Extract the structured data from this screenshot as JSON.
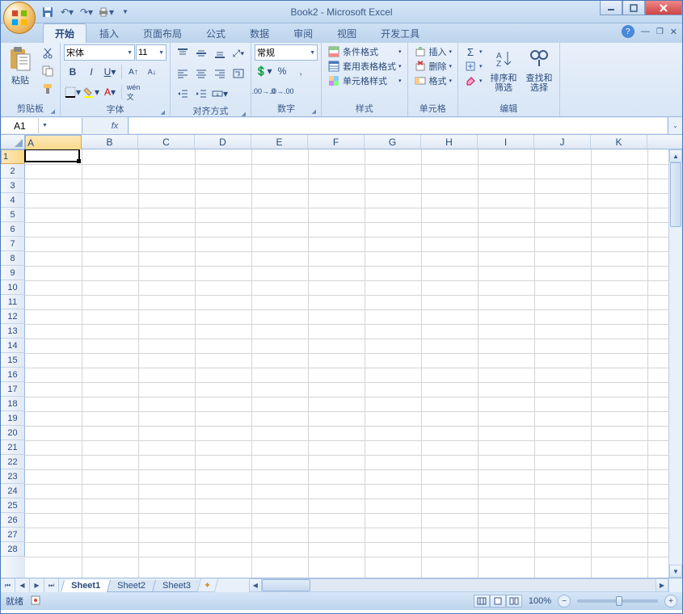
{
  "title": "Book2 - Microsoft Excel",
  "qat": {
    "save": "💾",
    "undo": "↶",
    "redo": "↷",
    "print": "🖨"
  },
  "tabs": [
    "开始",
    "插入",
    "页面布局",
    "公式",
    "数据",
    "审阅",
    "视图",
    "开发工具"
  ],
  "active_tab": 0,
  "ribbon": {
    "clipboard": {
      "label": "剪贴板",
      "paste": "粘贴"
    },
    "font": {
      "label": "字体",
      "name": "宋体",
      "size": "11"
    },
    "alignment": {
      "label": "对齐方式"
    },
    "number": {
      "label": "数字",
      "format": "常规"
    },
    "styles": {
      "label": "样式",
      "cond": "条件格式",
      "tablefmt": "套用表格格式",
      "cellstyle": "单元格样式"
    },
    "cells": {
      "label": "单元格",
      "insert": "插入",
      "delete": "删除",
      "format": "格式"
    },
    "editing": {
      "label": "编辑",
      "sort": "排序和\n筛选",
      "find": "查找和\n选择"
    }
  },
  "namebox": "A1",
  "formula": "",
  "columns": [
    "A",
    "B",
    "C",
    "D",
    "E",
    "F",
    "G",
    "H",
    "I",
    "J",
    "K"
  ],
  "rows": [
    1,
    2,
    3,
    4,
    5,
    6,
    7,
    8,
    9,
    10,
    11,
    12,
    13,
    14,
    15,
    16,
    17,
    18,
    19,
    20,
    21,
    22,
    23,
    24,
    25,
    26,
    27,
    28
  ],
  "active_cell": {
    "col": 0,
    "row": 0
  },
  "sheets": [
    "Sheet1",
    "Sheet2",
    "Sheet3"
  ],
  "active_sheet": 0,
  "status": {
    "ready": "就绪",
    "zoom": "100%"
  }
}
